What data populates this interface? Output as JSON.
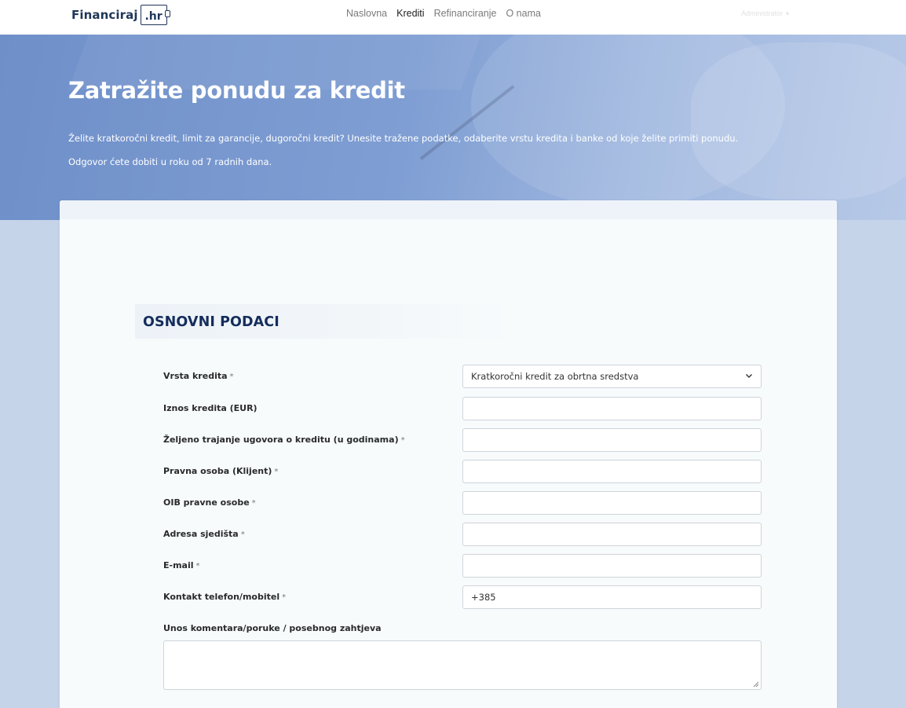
{
  "logo": {
    "text": "Financiraj",
    "box_text": ".hr"
  },
  "nav": {
    "items": [
      "Naslovna",
      "Krediti",
      "Refinanciranje",
      "O nama"
    ],
    "active": "Krediti"
  },
  "user": {
    "name": "Administrator"
  },
  "hero": {
    "title": "Zatražite ponudu za kredit",
    "text1": "Želite kratkoročni kredit, limit za garancije, dugoročni kredit? Unesite tražene podatke, odaberite vrstu kredita i banke od koje želite primiti ponudu.",
    "text2": "Odgovor ćete dobiti u roku od 7 radnih dana."
  },
  "section": {
    "title": "OSNOVNI PODACI"
  },
  "form": {
    "fields": [
      {
        "label": "Vrsta kredita",
        "required": "*",
        "type": "select",
        "value": "Kratkoročni kredit za obrtna sredstva"
      },
      {
        "label": "Iznos kredita (EUR)",
        "required": "",
        "type": "text",
        "value": ""
      },
      {
        "label": "Željeno trajanje ugovora o kreditu (u godinama)",
        "required": "*",
        "type": "text",
        "value": ""
      },
      {
        "label": "Pravna osoba (Klijent)",
        "required": "*",
        "type": "text",
        "value": ""
      },
      {
        "label": "OIB pravne osobe",
        "required": "*",
        "type": "text",
        "value": ""
      },
      {
        "label": "Adresa sjedišta",
        "required": "*",
        "type": "text",
        "value": ""
      },
      {
        "label": "E-mail",
        "required": "*",
        "type": "text",
        "value": ""
      },
      {
        "label": "Kontakt telefon/mobitel",
        "required": "*",
        "type": "text",
        "value": "+385"
      }
    ],
    "comment_label": "Unos komentara/poruke / posebnog zahtjeva",
    "comment_value": ""
  },
  "colors": {
    "brand": "#1f3558",
    "section_title": "#142d5c",
    "hero": "#7f9ed3",
    "page_bg": "#c6d4ea"
  },
  "icons": {
    "select": "chevron-down-icon",
    "resize": "resize-grip-icon",
    "user_menu": "chevron-down-icon"
  }
}
